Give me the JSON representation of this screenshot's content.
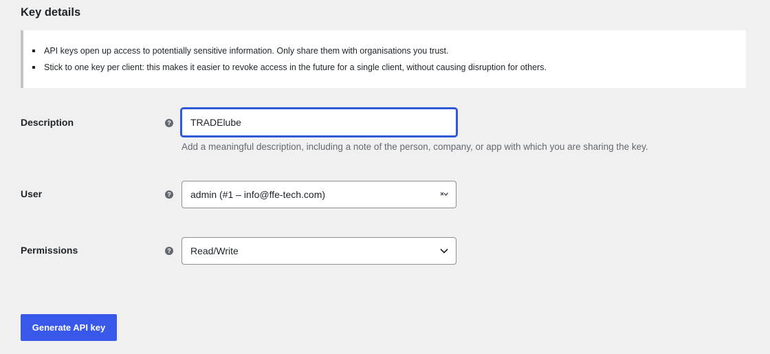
{
  "section": {
    "title": "Key details"
  },
  "notice": {
    "items": [
      "API keys open up access to potentially sensitive information. Only share them with organisations you trust.",
      "Stick to one key per client: this makes it easier to revoke access in the future for a single client, without causing disruption for others."
    ]
  },
  "form": {
    "description": {
      "label": "Description",
      "value": "TRADElube",
      "help": "Add a meaningful description, including a note of the person, company, or app with which you are sharing the key.",
      "help_icon": "question-icon"
    },
    "user": {
      "label": "User",
      "selected": "admin (#1 – info@ffe-tech.com)",
      "help_icon": "question-icon",
      "arrow_icon": "clear-dropdown-icon"
    },
    "permissions": {
      "label": "Permissions",
      "selected": "Read/Write",
      "help_icon": "question-icon",
      "arrow_icon": "chevron-down-icon"
    }
  },
  "actions": {
    "generate_label": "Generate API key"
  },
  "colors": {
    "primary": "#3858e9",
    "focus_border": "#2f59d6",
    "background": "#f0f0f1"
  }
}
